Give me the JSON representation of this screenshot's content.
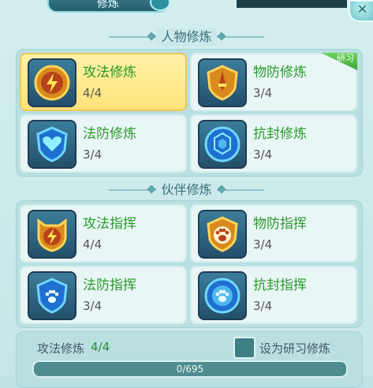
{
  "header": {
    "tab_title": "修炼",
    "close_label": "✕"
  },
  "sections": {
    "personal": {
      "title": "人物修炼",
      "cards": [
        {
          "name": "攻法修炼",
          "level": "4/4",
          "icon": "lightning-shield-icon",
          "selected": true
        },
        {
          "name": "物防修炼",
          "level": "3/4",
          "icon": "sword-shield-icon",
          "tag": "研习"
        },
        {
          "name": "法防修炼",
          "level": "3/4",
          "icon": "heart-shield-icon"
        },
        {
          "name": "抗封修炼",
          "level": "3/4",
          "icon": "turtle-shell-icon"
        }
      ]
    },
    "partner": {
      "title": "伙伴修炼",
      "cards": [
        {
          "name": "攻法指挥",
          "level": "4/4",
          "icon": "lightning-cat-icon"
        },
        {
          "name": "物防指挥",
          "level": "3/4",
          "icon": "paw-shield-gold-icon"
        },
        {
          "name": "法防指挥",
          "level": "3/4",
          "icon": "paw-shield-blue-icon"
        },
        {
          "name": "抗封指挥",
          "level": "3/4",
          "icon": "paw-orb-icon"
        }
      ]
    }
  },
  "bottom": {
    "name": "攻法修炼",
    "level": "4/4",
    "checkbox_label": "设为研习修炼",
    "progress_text": "0/695",
    "progress_fraction": 0
  },
  "colors": {
    "name_green": "#2a9a2a",
    "selected_bg": "#ffe27a"
  }
}
